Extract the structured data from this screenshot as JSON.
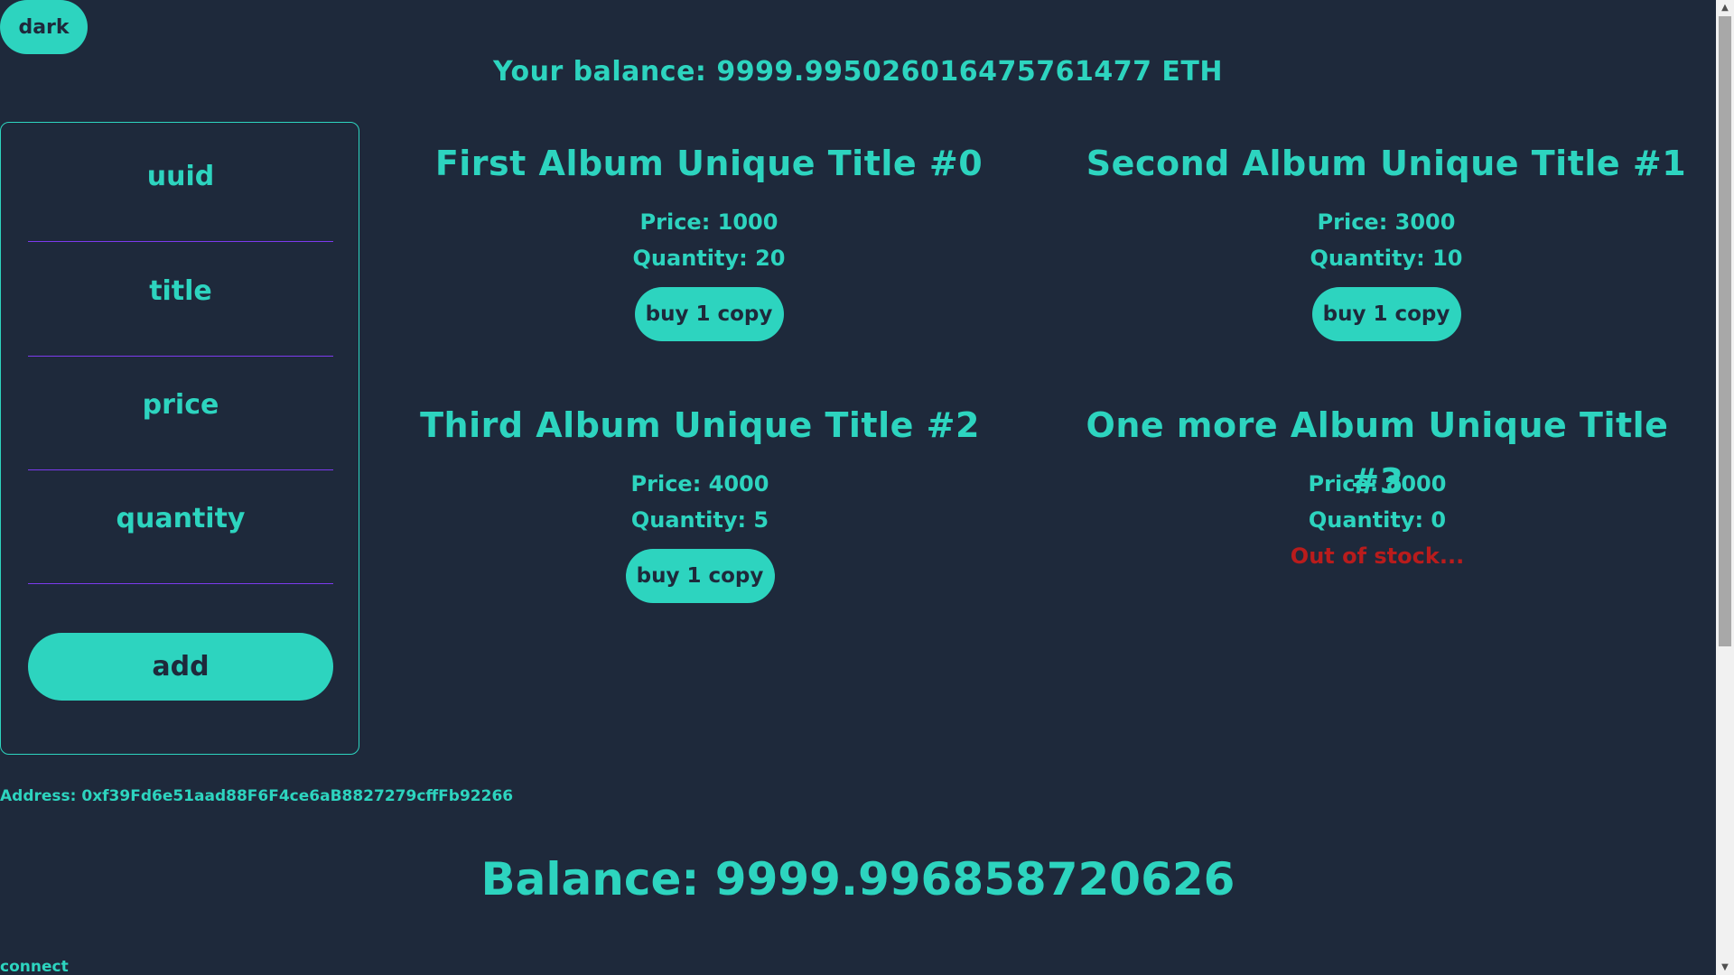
{
  "theme_toggle": {
    "label": "dark"
  },
  "header": {
    "balance": "Your balance: 9999.995026016475761477 ETH"
  },
  "form": {
    "fields": [
      {
        "label": "uuid",
        "value": ""
      },
      {
        "label": "title",
        "value": ""
      },
      {
        "label": "price",
        "value": ""
      },
      {
        "label": "quantity",
        "value": ""
      }
    ],
    "add_label": "add"
  },
  "albums": [
    {
      "title": "First Album Unique Title #0",
      "price": "Price: 1000",
      "quantity": "Quantity: 20",
      "action": "buy 1 copy"
    },
    {
      "title": "Second Album Unique Title #1",
      "price": "Price: 3000",
      "quantity": "Quantity: 10",
      "action": "buy 1 copy"
    },
    {
      "title": "Third Album Unique Title #2",
      "price": "Price: 4000",
      "quantity": "Quantity: 5",
      "action": "buy 1 copy"
    },
    {
      "title": "One more Album Unique Title #3",
      "price": "Price: 8000",
      "quantity": "Quantity: 0",
      "status": "Out of stock..."
    }
  ],
  "wallet": {
    "address": "Address: 0xf39Fd6e51aad88F6F4ce6aB8827279cffFb92266",
    "balance": "Balance: 9999.996858720626",
    "connect_label": "connect"
  },
  "colors": {
    "background": "#1e293b",
    "accent": "#2dd4bf",
    "field_underline": "#7c3aed",
    "out_of_stock": "#b91c1c"
  }
}
